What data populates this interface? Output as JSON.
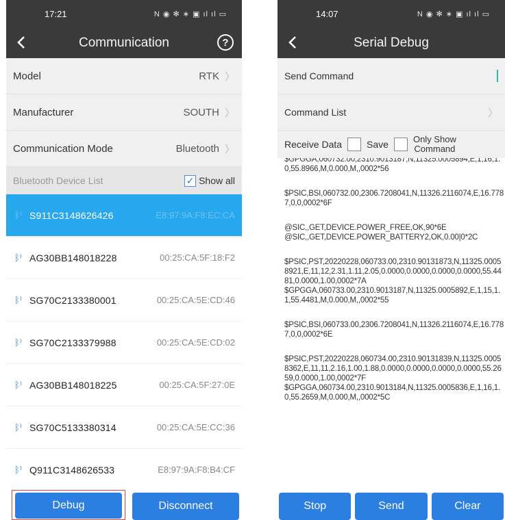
{
  "left": {
    "status_time": "17:21",
    "status_icons": "N ◉ ✻ ∗ ▣ ıl ıl ▭",
    "title": "Communication",
    "help": "?",
    "settings": [
      {
        "label": "Model",
        "value": "RTK"
      },
      {
        "label": "Manufacturer",
        "value": "SOUTH"
      },
      {
        "label": "Communication Mode",
        "value": "Bluetooth"
      }
    ],
    "list_header": "Bluetooth Device List",
    "show_all": "Show all",
    "devices": [
      {
        "name": "S911C3148626426",
        "mac": "E8:97:9A:F8:EC:CA"
      },
      {
        "name": "AG30BB148018228",
        "mac": "00:25:CA:5F:18:F2"
      },
      {
        "name": "SG70C2133380001",
        "mac": "00:25:CA:5E:CD:46"
      },
      {
        "name": "SG70C2133379988",
        "mac": "00:25:CA:5E:CD:02"
      },
      {
        "name": "AG30BB148018225",
        "mac": "00:25:CA:5F:27:0E"
      },
      {
        "name": "SG70C5133380314",
        "mac": "00:25:CA:5E:CC:36"
      },
      {
        "name": "Q911C3148626533",
        "mac": "E8:97:9A:F8:B4:CF"
      }
    ],
    "debug_label": "Debug",
    "disconnect_label": "Disconnect"
  },
  "right": {
    "status_time": "14:07",
    "status_icons": "N ◉ ✻ ∗ ▣ ıl ıl ▭",
    "title": "Serial Debug",
    "send_command": "Send Command",
    "command_list": "Command List",
    "receive_data": "Receive Data",
    "save": "Save",
    "only_show_line1": "Only Show",
    "only_show_line2": "Command",
    "log": [
      "$GPGGA,060732.00,2310.9013187,N,11325.0005894,E,1,16,1.0,55.8966,M,0.000,M,,0002*56",
      "$PSIC,BSI,060732.00,2306.7208041,N,11326.2116074,E,16.7787,0,0,0002*6F",
      "@SIC,,GET,DEVICE.POWER_FREE,OK,90*6E\n@SIC,,GET,DEVICE.POWER_BATTERY2,OK,0.00|0*2C",
      "$PSIC,PST,20220228,060733.00,2310.90131873,N,11325.00058921,E,11,12,2.31,1.11,2.05,0.0000,0.0000,0.0000,0.0000,55.4481,0.0000,1.00,0002*7A\n$GPGGA,060733.00,2310.9013187,N,11325.0005892,E,1,15,1.1,55.4481,M,0.000,M,,0002*55",
      "$PSIC,BSI,060733.00,2306.7208041,N,11326.2116074,E,16.7787,0,0,0002*6E",
      "$PSIC,PST,20220228,060734.00,2310.90131839,N,11325.00058362,E,11,11,2.16,1.00,1.88,0.0000,0.0000,0.0000,0.0000,55.2659,0.0000,1.00,0002*7F\n$GPGGA,060734.00,2310.9013184,N,11325.0005836,E,1,16,1.0,55.2659,M,0.000,M,,0002*5C"
    ],
    "stop_label": "Stop",
    "send_label": "Send",
    "clear_label": "Clear"
  }
}
